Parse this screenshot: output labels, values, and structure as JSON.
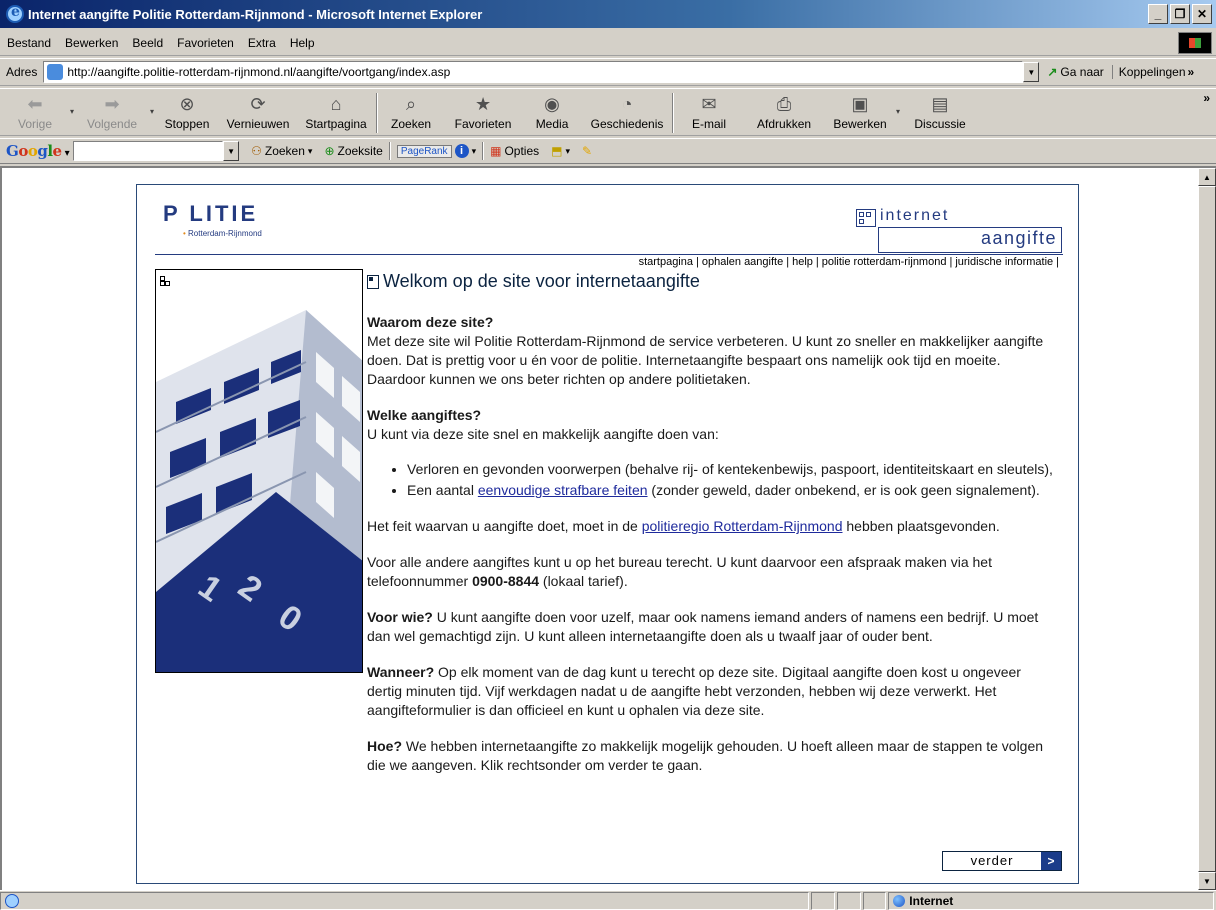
{
  "window": {
    "title": "Internet aangifte Politie Rotterdam-Rijnmond - Microsoft Internet Explorer"
  },
  "menu": [
    "Bestand",
    "Bewerken",
    "Beeld",
    "Favorieten",
    "Extra",
    "Help"
  ],
  "address": {
    "label": "Adres",
    "url": "http://aangifte.politie-rotterdam-rijnmond.nl/aangifte/voortgang/index.asp",
    "go_label": "Ga naar",
    "links_label": "Koppelingen"
  },
  "toolbar": {
    "back": "Vorige",
    "forward": "Volgende",
    "stop": "Stoppen",
    "refresh": "Vernieuwen",
    "home": "Startpagina",
    "search": "Zoeken",
    "favorites": "Favorieten",
    "media": "Media",
    "history": "Geschiedenis",
    "mail": "E-mail",
    "print": "Afdrukken",
    "edit": "Bewerken",
    "discuss": "Discussie"
  },
  "googlebar": {
    "search_value": "",
    "zoeken": "Zoeken",
    "zoeksite": "Zoeksite",
    "pagerank": "PageRank",
    "opties": "Opties"
  },
  "site": {
    "logo_text": "P LITIE",
    "logo_sub": "Rotterdam-Rijnmond",
    "brand_top": "internet",
    "brand_bottom": "aangifte",
    "nav": [
      "startpagina",
      "ophalen aangifte",
      "help",
      "politie rotterdam-rijnmond",
      "juridische informatie"
    ],
    "heading": "Welkom op de site voor internetaangifte",
    "why_title": "Waarom deze site?",
    "why_text": "Met deze site wil Politie Rotterdam-Rijnmond de service verbeteren. U kunt zo sneller en makkelijker aangifte doen. Dat is prettig voor u én voor de politie. Internetaangifte bespaart ons namelijk ook tijd en moeite. Daardoor kunnen we ons beter richten op andere politietaken.",
    "which_title": "Welke aangiftes?",
    "which_text": "U kunt via deze site snel en makkelijk aangifte doen van:",
    "bullet1": "Verloren en gevonden voorwerpen (behalve rij- of kentekenbewijs, paspoort, identiteitskaart en sleutels),",
    "bullet2_pre": "Een aantal ",
    "bullet2_link": "eenvoudige strafbare feiten",
    "bullet2_post": " (zonder geweld, dader onbekend, er is ook geen signalement).",
    "region_pre": "Het feit waarvan u aangifte doet, moet in de ",
    "region_link": "politieregio Rotterdam-Rijnmond",
    "region_post": " hebben plaatsgevonden.",
    "other_pre": "Voor alle andere aangiftes kunt u op het bureau terecht. U kunt daarvoor een afspraak maken via het telefoonnummer ",
    "other_phone": "0900-8844",
    "other_post": " (lokaal tarief).",
    "who_title": "Voor wie?",
    "who_text": " U kunt aangifte doen voor uzelf, maar ook namens iemand anders of namens een bedrijf. U moet dan wel gemachtigd zijn. U kunt alleen internetaangifte doen als u twaalf jaar of ouder bent.",
    "when_title": "Wanneer?",
    "when_text": " Op elk moment van de dag kunt u terecht op deze site. Digitaal aangifte doen kost u ongeveer dertig minuten tijd. Vijf werkdagen nadat u de aangifte hebt verzonden, hebben wij deze verwerkt. Het aangifteformulier is dan officieel en kunt u ophalen via deze site.",
    "how_title": "Hoe?",
    "how_text": " We hebben internetaangifte zo makkelijk mogelijk gehouden. U hoeft alleen maar de stappen te volgen die we aangeven. Klik rechtsonder om verder te gaan.",
    "next_label": "verder",
    "next_arrow": ">"
  },
  "status": {
    "zone": "Internet"
  },
  "colors": {
    "title_bar": "#0a246a",
    "brand_blue": "#243b80",
    "link": "#1e2a9c",
    "frame_border": "#2a4a78"
  }
}
